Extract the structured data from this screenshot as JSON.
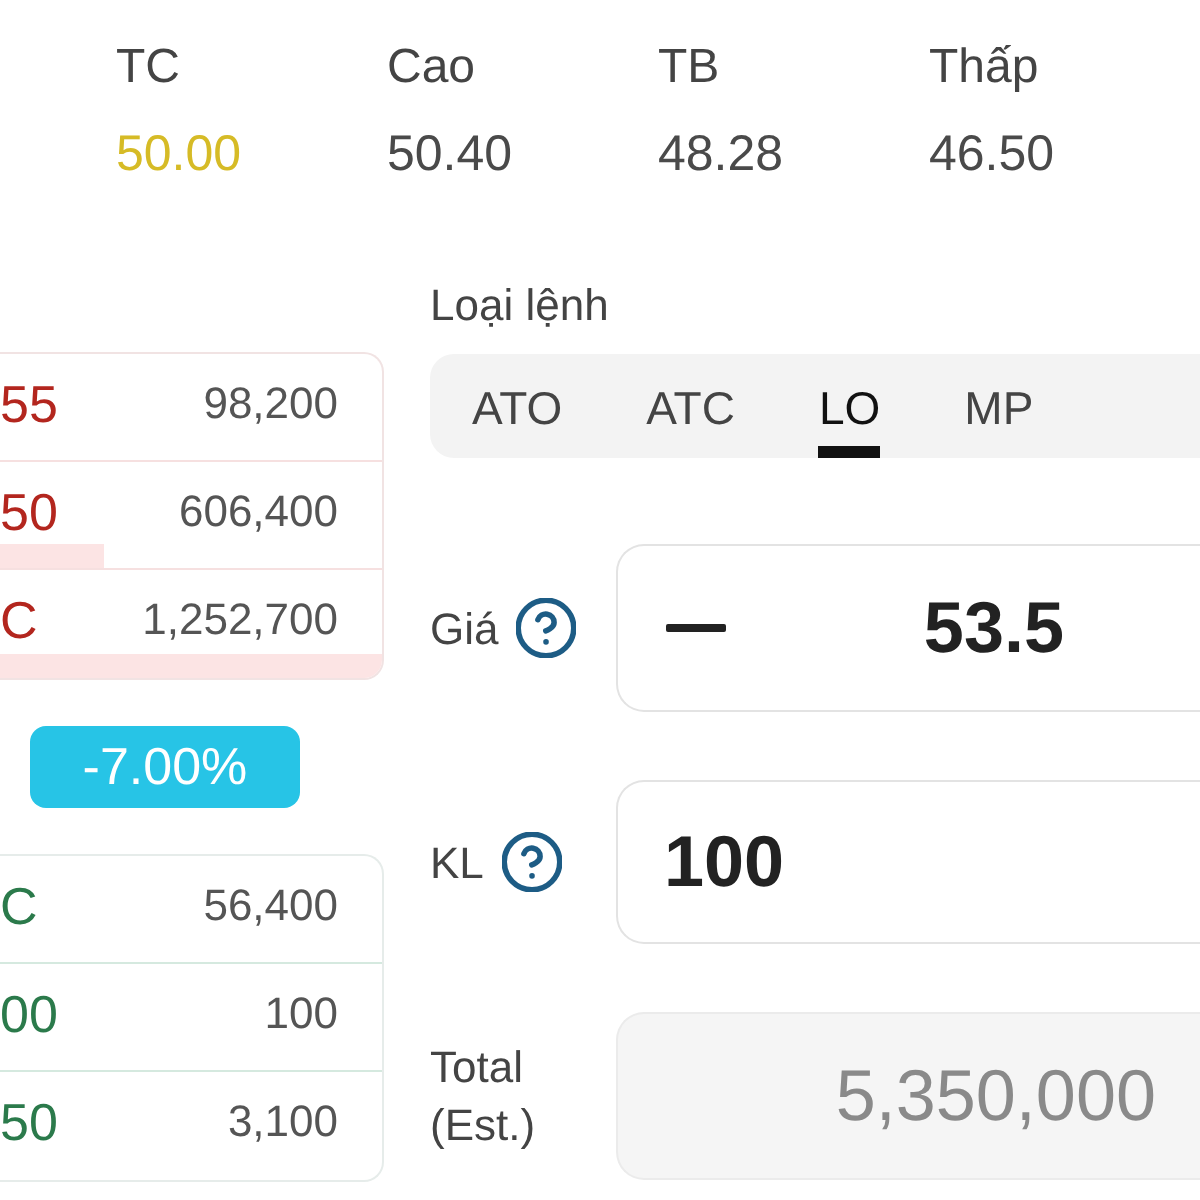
{
  "stats": [
    {
      "label": "TC",
      "value": "50.00",
      "color": "#d6bb26"
    },
    {
      "label": "Cao",
      "value": "50.40",
      "color": "#4a4a4a"
    },
    {
      "label": "TB",
      "value": "48.28",
      "color": "#4a4a4a"
    },
    {
      "label": "Thấp",
      "value": "46.50",
      "color": "#4a4a4a"
    }
  ],
  "order_book": {
    "asks": [
      {
        "price": "55",
        "volume": "98,200"
      },
      {
        "price": "50",
        "volume": "606,400",
        "level": 0.27
      },
      {
        "price": "C",
        "volume": "1,252,700",
        "level": 1
      }
    ],
    "change_badge": "-7.00%",
    "bids": [
      {
        "price": "C",
        "volume": "56,400"
      },
      {
        "price": "00",
        "volume": "100"
      },
      {
        "price": "50",
        "volume": "3,100"
      }
    ]
  },
  "order_form": {
    "order_type_label": "Loại lệnh",
    "order_types": [
      {
        "label": "ATO",
        "selected": false
      },
      {
        "label": "ATC",
        "selected": false
      },
      {
        "label": "LO",
        "selected": true
      },
      {
        "label": "MP",
        "selected": false
      }
    ],
    "fields": [
      {
        "kind": "stepper",
        "label": "Giá",
        "help": true,
        "value": "53.5"
      },
      {
        "kind": "input",
        "label": "KL",
        "help": true,
        "value": "100"
      },
      {
        "kind": "readonly",
        "label": "Total (Est.)",
        "help": false,
        "value": "5,350,000"
      }
    ]
  }
}
